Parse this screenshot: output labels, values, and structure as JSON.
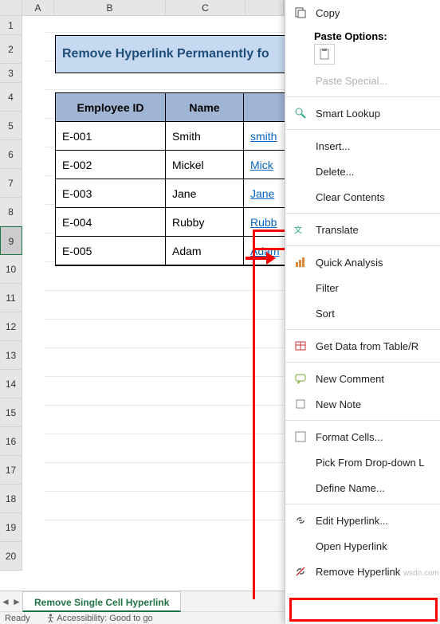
{
  "columns": [
    "A",
    "B",
    "C"
  ],
  "rows": [
    "1",
    "2",
    "3",
    "4",
    "5",
    "6",
    "7",
    "8",
    "9",
    "10",
    "11",
    "12",
    "13",
    "14",
    "15",
    "16",
    "17",
    "18",
    "19",
    "20"
  ],
  "title_text": "Remove Hyperlink Permanently fo",
  "headers": {
    "b": "Employee ID",
    "c": "Name"
  },
  "data_rows": [
    {
      "id": "E-001",
      "name": "Smith",
      "email": "smith"
    },
    {
      "id": "E-002",
      "name": "Mickel",
      "email": "Mick"
    },
    {
      "id": "E-003",
      "name": "Jane",
      "email": "Jane"
    },
    {
      "id": "E-004",
      "name": "Rubby",
      "email": "Rubb"
    },
    {
      "id": "E-005",
      "name": "Adam",
      "email": "Adam"
    }
  ],
  "sheet_tab": "Remove Single Cell Hyperlink",
  "status": {
    "ready": "Ready",
    "accessibility": "Accessibility: Good to go"
  },
  "menu": {
    "copy": "Copy",
    "paste_options": "Paste Options:",
    "paste_special": "Paste Special...",
    "smart_lookup": "Smart Lookup",
    "insert": "Insert...",
    "delete": "Delete...",
    "clear_contents": "Clear Contents",
    "translate": "Translate",
    "quick_analysis": "Quick Analysis",
    "filter": "Filter",
    "sort": "Sort",
    "get_data": "Get Data from Table/R",
    "new_comment": "New Comment",
    "new_note": "New Note",
    "format_cells": "Format Cells...",
    "pick_from": "Pick From Drop-down L",
    "define_name": "Define Name...",
    "edit_hyperlink": "Edit Hyperlink...",
    "open_hyperlink": "Open Hyperlink",
    "remove_hyperlink": "Remove Hyperlink",
    "watermark": "wsdn.com"
  }
}
